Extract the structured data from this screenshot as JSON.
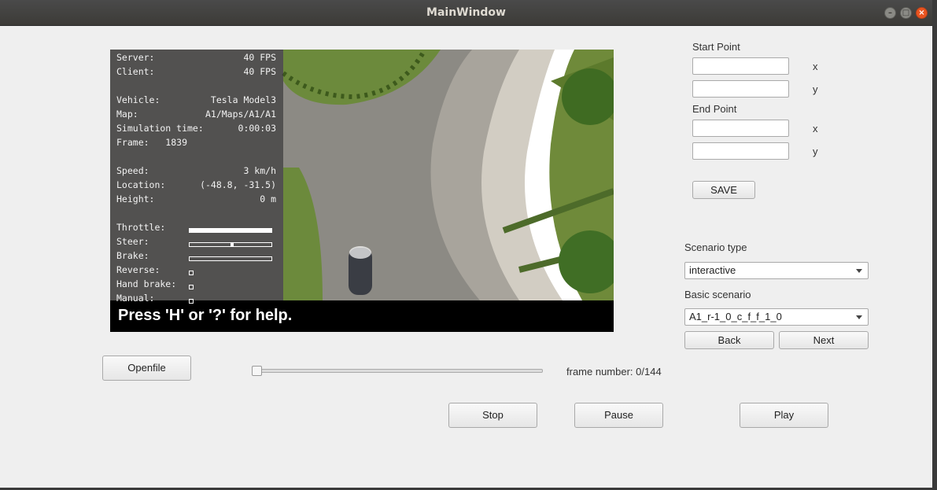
{
  "window": {
    "title": "MainWindow"
  },
  "hud": {
    "server_label": "Server:",
    "server_value": "40 FPS",
    "client_label": "Client:",
    "client_value": "40 FPS",
    "vehicle_label": "Vehicle:",
    "vehicle_value": "Tesla Model3",
    "map_label": "Map:",
    "map_value": "A1/Maps/A1/A1",
    "simtime_label": "Simulation time:",
    "simtime_value": "0:00:03",
    "frame_text": "Frame:   1839",
    "speed_label": "Speed:",
    "speed_value": "3 km/h",
    "location_label": "Location:",
    "location_value": "(-48.8, -31.5)",
    "height_label": "Height:",
    "height_value": "0 m",
    "throttle_label": "Throttle:",
    "throttle_level": 1.0,
    "steer_label": "Steer:",
    "steer_level": 0.0,
    "brake_label": "Brake:",
    "brake_level": 0.0,
    "reverse_label": "Reverse:",
    "handbrake_label": "Hand brake:",
    "manual_label": "Manual:",
    "help_text": "Press 'H' or '?' for help."
  },
  "form": {
    "start_point_label": "Start Point",
    "end_point_label": "End Point",
    "x_label": "x",
    "y_label": "y",
    "save_label": "SAVE",
    "scenario_type_label": "Scenario type",
    "scenario_type_value": "interactive",
    "basic_scenario_label": "Basic scenario",
    "basic_scenario_value": "A1_r-1_0_c_f_f_1_0",
    "back_label": "Back",
    "next_label": "Next"
  },
  "playback": {
    "openfile_label": "Openfile",
    "frame_text": "frame number: 0/144",
    "stop_label": "Stop",
    "pause_label": "Pause",
    "play_label": "Play"
  }
}
